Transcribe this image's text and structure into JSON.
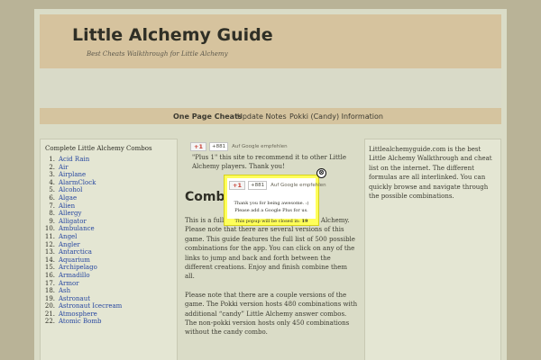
{
  "header": {
    "title": "Little Alchemy Guide",
    "tagline": "Best Cheats Walkthrough for Little Alchemy"
  },
  "nav": {
    "items": [
      "One Page Cheats",
      "Update Notes",
      "Pokki (Candy) Information"
    ]
  },
  "sidebar_left": {
    "title": "Complete Little Alchemy Combos",
    "items": [
      "Acid Rain",
      "Air",
      "Airplane",
      "AlarmClock",
      "Alcohol",
      "Algae",
      "Alien",
      "Allergy",
      "Alligator",
      "Ambulance",
      "Angel",
      "Angler",
      "Antarctica",
      "Aquarium",
      "Archipelago",
      "Armadillo",
      "Armor",
      "Ash",
      "Astronaut",
      "Astronaut Icecream",
      "Atmosphere",
      "Atomic Bomb"
    ]
  },
  "center": {
    "plus_one_button": "+1",
    "plus_one_count": "+881",
    "plus_one_label": "Auf Google empfehlen",
    "share_text": "\"Plus 1\" this site to recommend it to other Little Alchemy players. Thank you!",
    "heading": "Combos",
    "para1": "This is a full list of combinations for Little Alchemy. Please note that there are several versions of this game. This guide features the full list of 500 possible combinations for the app. You can click on any of the links to jump and back and forth between the different creations. Enjoy and finish combine them all.",
    "para2": "Please note that there are a couple versions of the game. The Pokki version hosts 480 combinations with additional “candy” Little Alchemy answer combos. The non-pokki version hosts only 450 combinations without the candy combo."
  },
  "sidebar_right": {
    "text": "Littlealchemyguide.com is the best Little Alchemy Walkthrough and cheat list on the internet. The different formulas are all interlinked. You can quickly browse and navigate through the possible combinations."
  },
  "popup": {
    "gplus_button": "+1",
    "gplus_count": "+881",
    "gplus_label": "Auf Google empfehlen",
    "line1": "Thank you for being awesome. :)",
    "line2": "Please add a Google Plus for us.",
    "timer_text": "This popup will be closed in:",
    "timer_value": "19",
    "close_symbol": "⊗"
  }
}
